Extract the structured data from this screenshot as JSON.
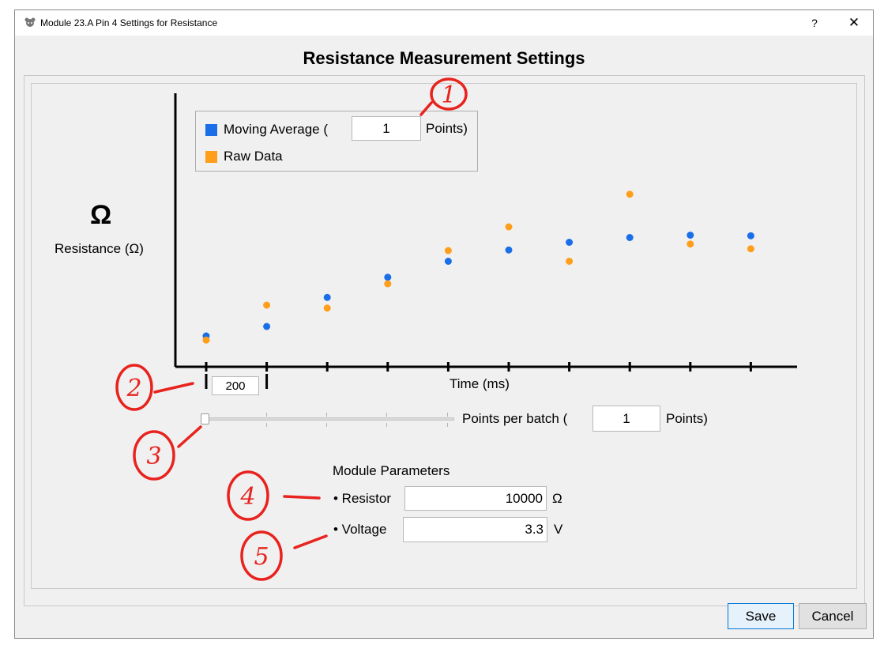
{
  "window": {
    "title": "Module 23.A Pin 4 Settings for Resistance",
    "help_label": "?",
    "close_label": "✕"
  },
  "dialog": {
    "heading": "Resistance Measurement Settings"
  },
  "chart_data": {
    "type": "scatter",
    "ylabel_symbol": "Ω",
    "ylabel": "Resistance (Ω)",
    "xlabel": "Time (ms)",
    "x": [
      1,
      2,
      3,
      4,
      5,
      6,
      7,
      8,
      9,
      10
    ],
    "series": [
      {
        "name": "Moving Average",
        "color": "#1a6ee8",
        "values": [
          52,
          68,
          117,
          151,
          178,
          197,
          210,
          218,
          222,
          221
        ]
      },
      {
        "name": "Raw Data",
        "color": "#ff9e1b",
        "values": [
          45,
          104,
          99,
          140,
          196,
          236,
          178,
          291,
          207,
          199
        ]
      }
    ],
    "ylim": [
      0,
      350
    ],
    "legend_position": "top-left",
    "grid": false
  },
  "legend": {
    "moving_average_prefix": "Moving Average (",
    "moving_average_points": "1",
    "moving_average_suffix": "Points)",
    "raw_data_label": "Raw Data"
  },
  "batch": {
    "width_value": "200",
    "slider_value": 0,
    "points_per_batch_label": "Points per batch (",
    "points_per_batch_value": "1",
    "points_per_batch_suffix": "Points)"
  },
  "module_parameters": {
    "heading": "Module Parameters",
    "resistor_label": "• Resistor",
    "resistor_value": "10000",
    "resistor_unit": "Ω",
    "voltage_label": "• Voltage",
    "voltage_value": "3.3",
    "voltage_unit": "V"
  },
  "buttons": {
    "save": "Save",
    "cancel": "Cancel"
  },
  "annotations": [
    "1",
    "2",
    "3",
    "4",
    "5"
  ]
}
